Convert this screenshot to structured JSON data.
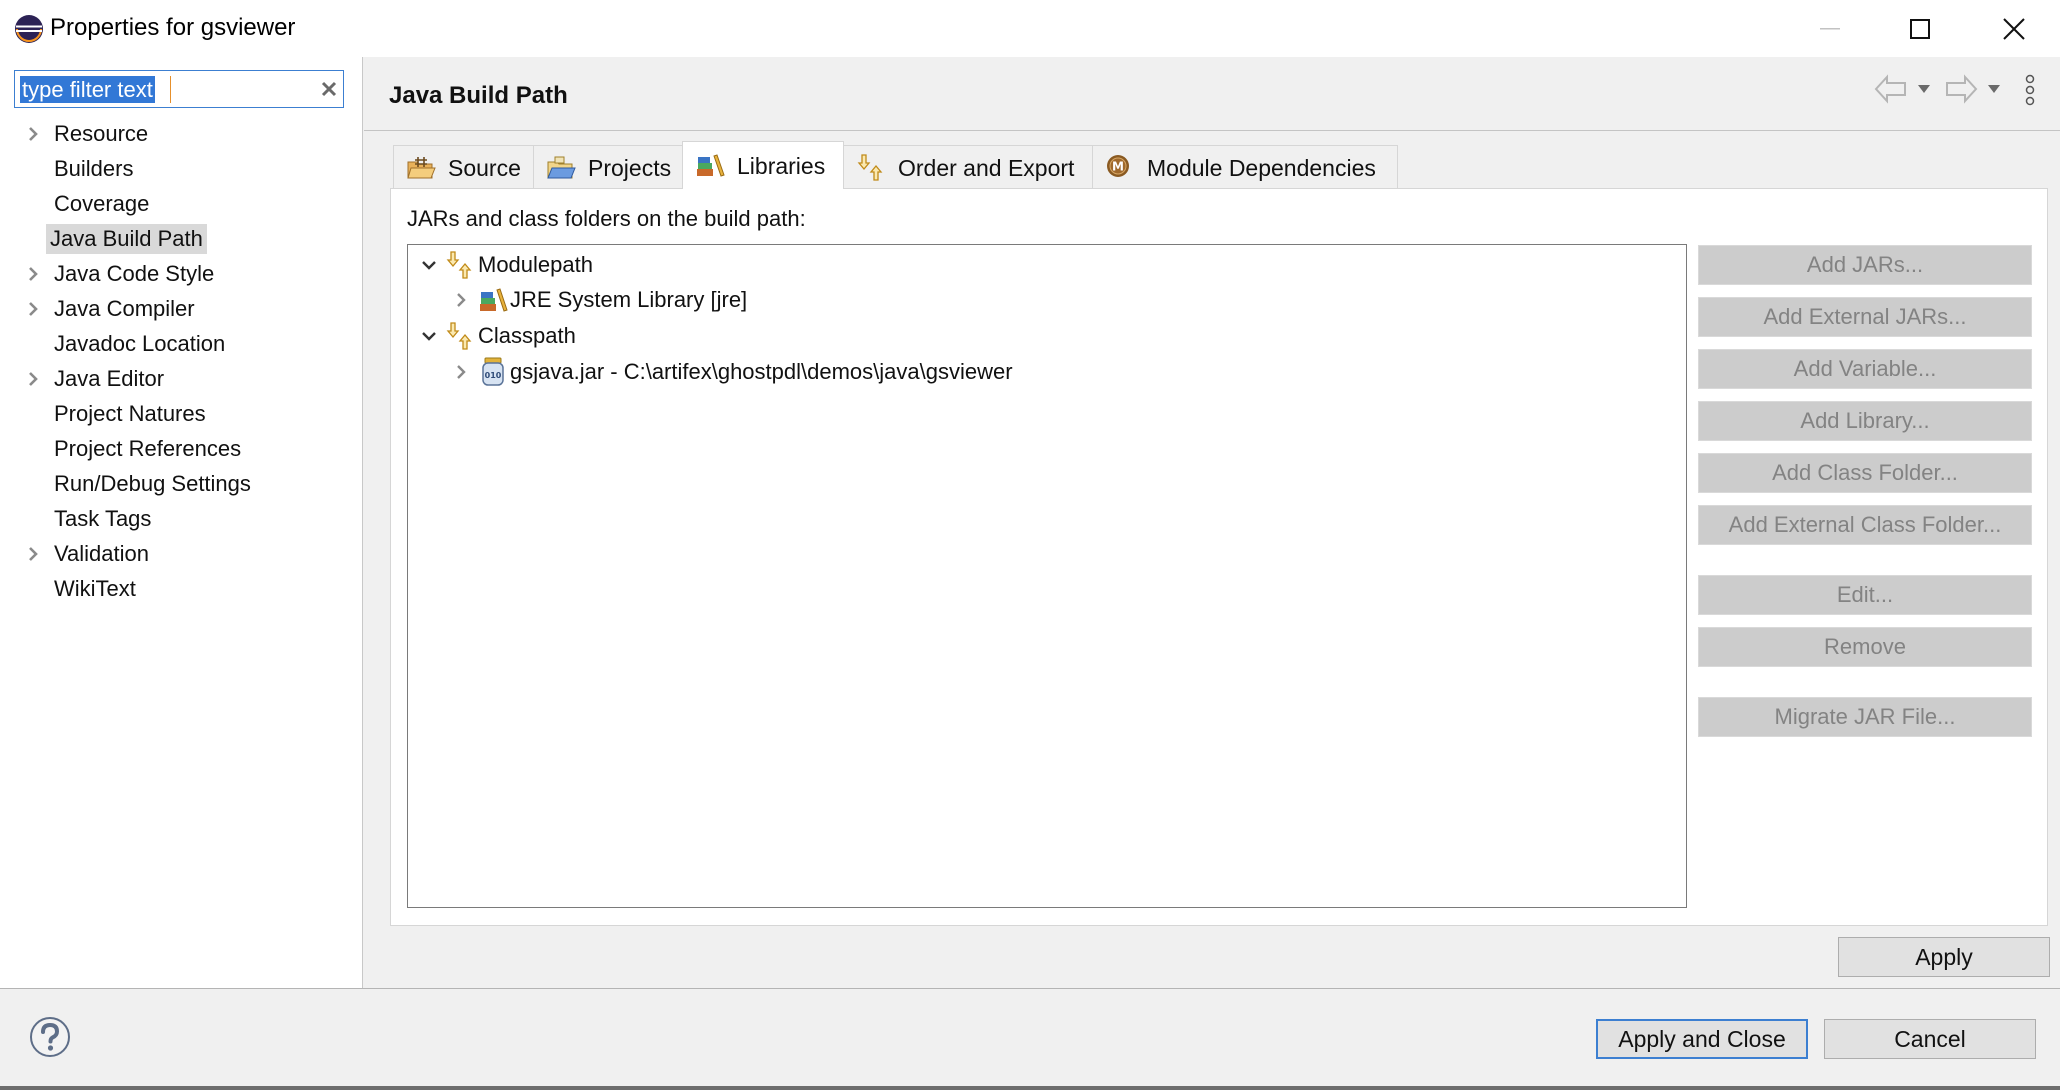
{
  "window": {
    "title": "Properties for gsviewer",
    "controls": {
      "minimize": "minimize-icon",
      "maximize": "maximize-icon",
      "close": "close-icon"
    }
  },
  "sidebar": {
    "filter": {
      "value": "type filter text",
      "placeholder": "type filter text",
      "selected_all": true
    },
    "items": [
      {
        "label": "Resource",
        "expandable": true,
        "selected": false
      },
      {
        "label": "Builders",
        "expandable": false,
        "selected": false
      },
      {
        "label": "Coverage",
        "expandable": false,
        "selected": false
      },
      {
        "label": "Java Build Path",
        "expandable": false,
        "selected": true
      },
      {
        "label": "Java Code Style",
        "expandable": true,
        "selected": false
      },
      {
        "label": "Java Compiler",
        "expandable": true,
        "selected": false
      },
      {
        "label": "Javadoc Location",
        "expandable": false,
        "selected": false
      },
      {
        "label": "Java Editor",
        "expandable": true,
        "selected": false
      },
      {
        "label": "Project Natures",
        "expandable": false,
        "selected": false
      },
      {
        "label": "Project References",
        "expandable": false,
        "selected": false
      },
      {
        "label": "Run/Debug Settings",
        "expandable": false,
        "selected": false
      },
      {
        "label": "Task Tags",
        "expandable": false,
        "selected": false
      },
      {
        "label": "Validation",
        "expandable": true,
        "selected": false
      },
      {
        "label": "WikiText",
        "expandable": false,
        "selected": false
      }
    ]
  },
  "main": {
    "title": "Java Build Path",
    "nav": {
      "back": "back-arrow-icon",
      "forward": "forward-arrow-icon",
      "menu": "more-vertical-icon"
    },
    "tabs": [
      {
        "label": "Source",
        "icon": "source-folder-icon",
        "selected": false
      },
      {
        "label": "Projects",
        "icon": "projects-folder-icon",
        "selected": false
      },
      {
        "label": "Libraries",
        "icon": "libraries-books-icon",
        "selected": true
      },
      {
        "label": "Order and Export",
        "icon": "order-export-arrows-icon",
        "selected": false
      },
      {
        "label": "Module Dependencies",
        "icon": "module-m-icon",
        "selected": false
      }
    ],
    "tree_caption": "JARs and class folders on the build path:",
    "tree": [
      {
        "label": "Modulepath",
        "level": 0,
        "expanded": true,
        "icon": "path-arrows-icon"
      },
      {
        "label": "JRE System Library [jre]",
        "level": 1,
        "expanded": false,
        "icon": "library-books-icon"
      },
      {
        "label": "Classpath",
        "level": 0,
        "expanded": true,
        "icon": "path-arrows-icon"
      },
      {
        "label": "gsjava.jar - C:\\artifex\\ghostpdl\\demos\\java\\gsviewer",
        "level": 1,
        "expanded": false,
        "icon": "jar-file-icon"
      }
    ],
    "side_buttons": [
      {
        "label": "Add JARs...",
        "enabled": false
      },
      {
        "label": "Add External JARs...",
        "enabled": false
      },
      {
        "label": "Add Variable...",
        "enabled": false
      },
      {
        "label": "Add Library...",
        "enabled": false
      },
      {
        "label": "Add Class Folder...",
        "enabled": false
      },
      {
        "label": "Add External Class Folder...",
        "enabled": false
      },
      {
        "label": "Edit...",
        "enabled": false
      },
      {
        "label": "Remove",
        "enabled": false
      },
      {
        "label": "Migrate JAR File...",
        "enabled": false
      }
    ],
    "apply_label": "Apply"
  },
  "footer": {
    "help": "help-icon",
    "apply_close_label": "Apply and Close",
    "cancel_label": "Cancel"
  },
  "colors": {
    "selection": "#3278d6",
    "focus_border": "#3c7fd1",
    "selected_nav_bg": "#d9d9d9",
    "disabled_text": "#838383",
    "disabled_bg": "#cccccc"
  }
}
